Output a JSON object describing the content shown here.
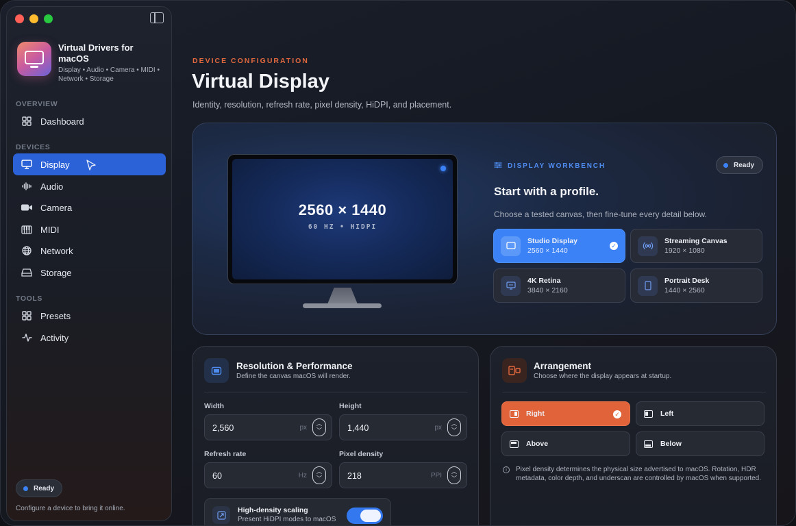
{
  "app": {
    "title": "Virtual Drivers for macOS",
    "subtitle": "Display • Audio • Camera • MIDI • Network • Storage"
  },
  "sidebar": {
    "sections": [
      {
        "label": "OVERVIEW",
        "items": [
          {
            "label": "Dashboard",
            "icon": "grid-icon"
          }
        ]
      },
      {
        "label": "DEVICES",
        "items": [
          {
            "label": "Display",
            "icon": "display-icon",
            "active": true
          },
          {
            "label": "Audio",
            "icon": "waveform-icon"
          },
          {
            "label": "Camera",
            "icon": "camera-icon"
          },
          {
            "label": "MIDI",
            "icon": "piano-keys-icon"
          },
          {
            "label": "Network",
            "icon": "globe-icon"
          },
          {
            "label": "Storage",
            "icon": "drive-icon"
          }
        ]
      },
      {
        "label": "TOOLS",
        "items": [
          {
            "label": "Presets",
            "icon": "grid-icon"
          },
          {
            "label": "Activity",
            "icon": "pulse-icon"
          }
        ]
      }
    ],
    "status": "Ready",
    "footer": "Configure a device to bring it online."
  },
  "header": {
    "eyebrow": "DEVICE CONFIGURATION",
    "title": "Virtual Display",
    "subtitle": "Identity, resolution, refresh rate, pixel density, HiDPI, and placement."
  },
  "preview": {
    "resolution": "2560 × 1440",
    "meta": "60 HZ  •  HIDPI"
  },
  "workbench": {
    "eyebrow": "DISPLAY WORKBENCH",
    "status": "Ready",
    "title": "Start with a profile.",
    "subtitle": "Choose a tested canvas, then fine-tune every detail below.",
    "profiles": [
      {
        "name": "Studio Display",
        "resolution": "2560 × 1440",
        "icon": "display-icon",
        "selected": true
      },
      {
        "name": "Streaming Canvas",
        "resolution": "1920 × 1080",
        "icon": "broadcast-icon"
      },
      {
        "name": "4K Retina",
        "resolution": "3840 × 2160",
        "icon": "tv-icon"
      },
      {
        "name": "Portrait Desk",
        "resolution": "1440 × 2560",
        "icon": "tablet-icon"
      }
    ]
  },
  "resolution_card": {
    "title": "Resolution & Performance",
    "subtitle": "Define the canvas macOS will render.",
    "fields": {
      "width": {
        "label": "Width",
        "value": "2,560",
        "unit": "px"
      },
      "height": {
        "label": "Height",
        "value": "1,440",
        "unit": "px"
      },
      "refresh": {
        "label": "Refresh rate",
        "value": "60",
        "unit": "Hz"
      },
      "density": {
        "label": "Pixel density",
        "value": "218",
        "unit": "PPI"
      }
    },
    "hidpi": {
      "title": "High-density scaling",
      "subtitle": "Present HiDPI modes to macOS",
      "enabled": true
    }
  },
  "arrangement_card": {
    "title": "Arrangement",
    "subtitle": "Choose where the display appears at startup.",
    "options": [
      {
        "label": "Right",
        "selected": true
      },
      {
        "label": "Left"
      },
      {
        "label": "Above"
      },
      {
        "label": "Below"
      }
    ],
    "note": "Pixel density determines the physical size advertised to macOS. Rotation, HDR metadata, color depth, and underscan are controlled by macOS when supported."
  },
  "colors": {
    "accent_blue": "#3b82f6",
    "accent_orange": "#e0633a"
  }
}
